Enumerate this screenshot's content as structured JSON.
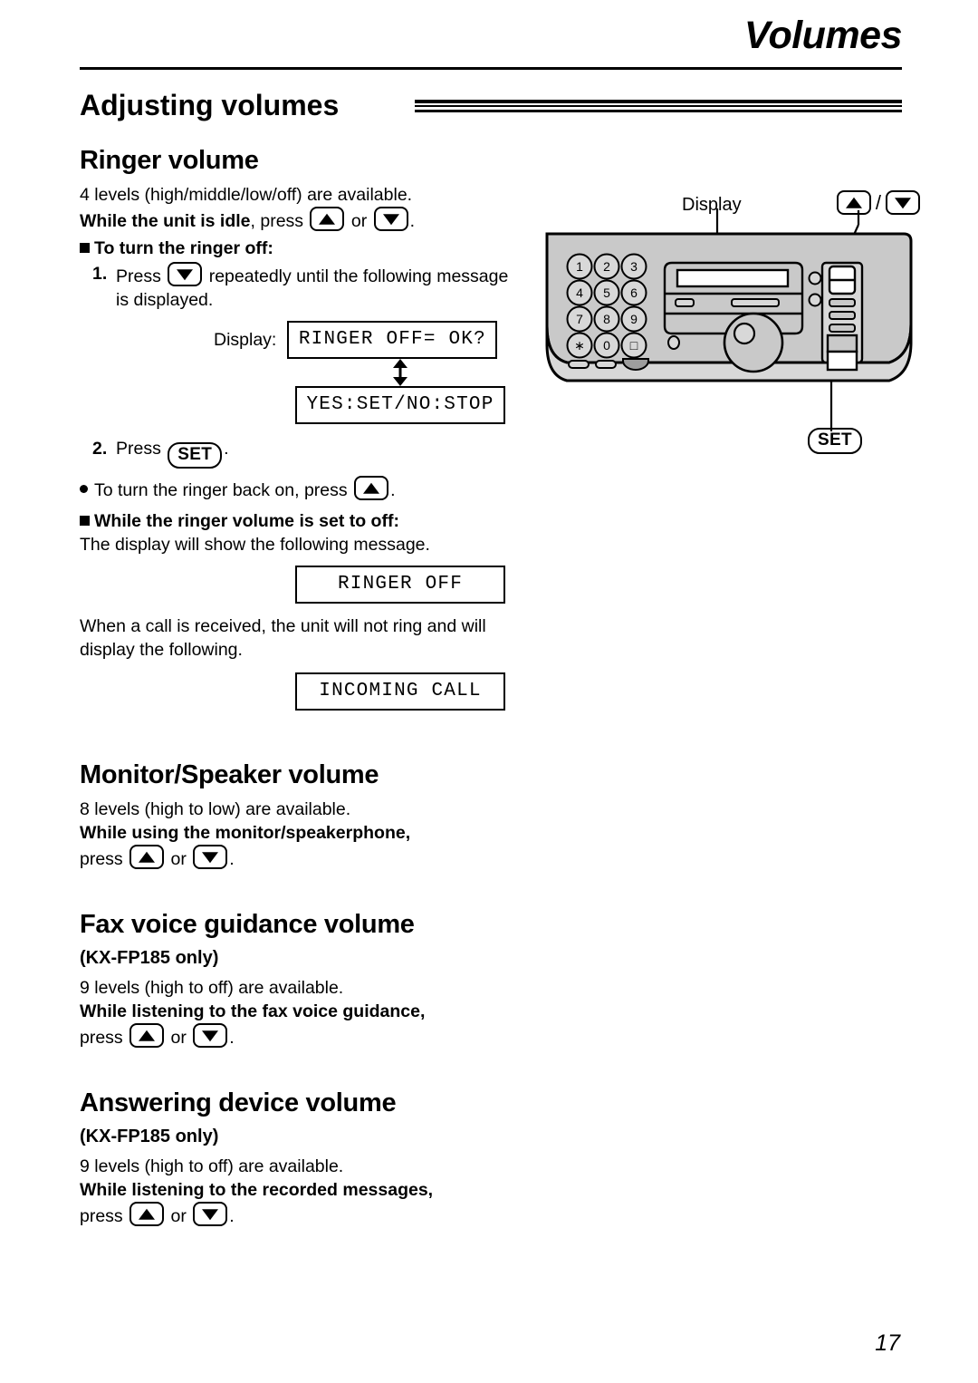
{
  "header": {
    "chapter_title": "Volumes",
    "section_title": "Adjusting volumes"
  },
  "sections": [
    {
      "heading": "Ringer volume",
      "intro": "4 levels (high/middle/low/off) are available.",
      "idle_bold": "While the unit is idle",
      "idle_rest_a": ", press",
      "idle_or": "or",
      "idle_end": ".",
      "block1_head": "To turn the ringer off:",
      "step1_num": "1.",
      "step1_text_a": "Press",
      "step1_text_b": "repeatedly until the following message is displayed.",
      "display_label": "Display:",
      "lcd1": "RINGER OFF= OK?",
      "lcd2": "YES:SET/NO:STOP",
      "step2_num": "2.",
      "step2_text_a": "Press",
      "step2_set": "SET",
      "step2_text_b": ".",
      "bullet1_a": "To turn the ringer back on, press",
      "bullet1_b": ".",
      "block2_head": "While the ringer volume is set to off:",
      "block2_body": "The display will show the following message.",
      "lcd3": "RINGER OFF",
      "block2_body2": "When a call is received, the unit will not ring and will display the following.",
      "lcd4": "INCOMING CALL"
    },
    {
      "heading": "Monitor/Speaker volume",
      "intro": "8 levels (high to low) are available.",
      "cond_bold": "While using the monitor/speakerphone,",
      "press_word": "press",
      "or_word": "or",
      "period": "."
    },
    {
      "heading": "Fax voice guidance volume",
      "model_note": "(KX-FP185 only)",
      "intro": "9 levels (high to off) are available.",
      "cond_bold": "While listening to the fax voice guidance,",
      "press_word": "press",
      "or_word": "or",
      "period": "."
    },
    {
      "heading": "Answering device volume",
      "model_note": "(KX-FP185 only)",
      "intro": "9 levels (high to off) are available.",
      "cond_bold": "While listening to the recorded messages,",
      "press_word": "press",
      "or_word": "or",
      "period": "."
    }
  ],
  "figure": {
    "display_callout": "Display",
    "updown_slash": "/",
    "set_callout": "SET",
    "keypad": [
      "1",
      "2",
      "3",
      "4",
      "5",
      "6",
      "7",
      "8",
      "9",
      "∗",
      "0",
      "□"
    ]
  },
  "page_number": "17",
  "colors": {
    "ink": "#000000",
    "paper": "#ffffff",
    "device_body": "#c9c9c9",
    "device_body_light": "#d8d8d8",
    "device_shadow": "#a8a8a8"
  }
}
